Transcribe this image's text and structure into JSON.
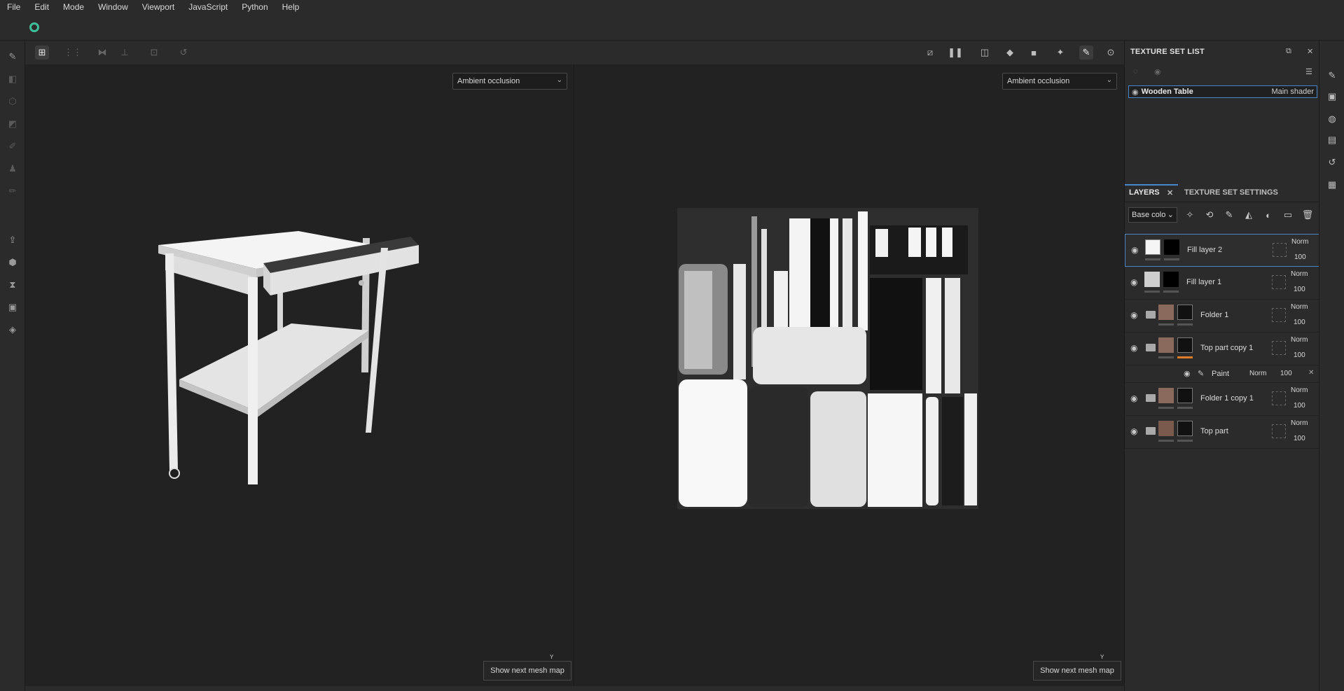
{
  "menu": [
    "File",
    "Edit",
    "Mode",
    "Window",
    "Viewport",
    "JavaScript",
    "Python",
    "Help"
  ],
  "viewport_left": {
    "channel": "Ambient occlusion",
    "mesh_button": "Show next mesh map",
    "axis": "Y"
  },
  "viewport_right": {
    "channel": "Ambient occlusion",
    "mesh_button": "Show next mesh map",
    "axis": "Y"
  },
  "texture_set_list": {
    "title": "TEXTURE SET LIST",
    "item": {
      "name": "Wooden Table",
      "shader": "Main shader"
    }
  },
  "layers_panel": {
    "tab_layers": "LAYERS",
    "tab_settings": "TEXTURE SET SETTINGS",
    "channel": "Base colo",
    "layers": [
      {
        "name": "Fill layer 2",
        "blend": "Norm",
        "opacity": "100",
        "type": "fill"
      },
      {
        "name": "Fill layer 1",
        "blend": "Norm",
        "opacity": "100",
        "type": "fill"
      },
      {
        "name": "Folder 1",
        "blend": "Norm",
        "opacity": "100",
        "type": "folder"
      },
      {
        "name": "Top part copy 1",
        "blend": "Norm",
        "opacity": "100",
        "type": "folder"
      },
      {
        "name": "Folder 1 copy 1",
        "blend": "Norm",
        "opacity": "100",
        "type": "folder"
      },
      {
        "name": "Top part",
        "blend": "Norm",
        "opacity": "100",
        "type": "folder"
      }
    ],
    "sublayer": {
      "name": "Paint",
      "blend": "Norm",
      "opacity": "100"
    }
  },
  "colors": {
    "accent": "#4a86c8",
    "logo": "#3fbf9b",
    "axis_y": "#35c95b",
    "wood": "#8a6a5c",
    "highlight": "#e07b2a"
  }
}
